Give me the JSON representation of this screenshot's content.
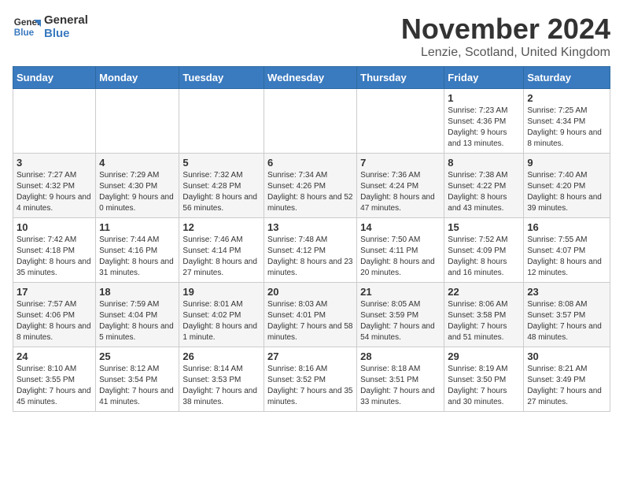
{
  "logo": {
    "line1": "General",
    "line2": "Blue"
  },
  "title": "November 2024",
  "location": "Lenzie, Scotland, United Kingdom",
  "days_of_week": [
    "Sunday",
    "Monday",
    "Tuesday",
    "Wednesday",
    "Thursday",
    "Friday",
    "Saturday"
  ],
  "weeks": [
    [
      {
        "day": "",
        "info": ""
      },
      {
        "day": "",
        "info": ""
      },
      {
        "day": "",
        "info": ""
      },
      {
        "day": "",
        "info": ""
      },
      {
        "day": "",
        "info": ""
      },
      {
        "day": "1",
        "info": "Sunrise: 7:23 AM\nSunset: 4:36 PM\nDaylight: 9 hours and 13 minutes."
      },
      {
        "day": "2",
        "info": "Sunrise: 7:25 AM\nSunset: 4:34 PM\nDaylight: 9 hours and 8 minutes."
      }
    ],
    [
      {
        "day": "3",
        "info": "Sunrise: 7:27 AM\nSunset: 4:32 PM\nDaylight: 9 hours and 4 minutes."
      },
      {
        "day": "4",
        "info": "Sunrise: 7:29 AM\nSunset: 4:30 PM\nDaylight: 9 hours and 0 minutes."
      },
      {
        "day": "5",
        "info": "Sunrise: 7:32 AM\nSunset: 4:28 PM\nDaylight: 8 hours and 56 minutes."
      },
      {
        "day": "6",
        "info": "Sunrise: 7:34 AM\nSunset: 4:26 PM\nDaylight: 8 hours and 52 minutes."
      },
      {
        "day": "7",
        "info": "Sunrise: 7:36 AM\nSunset: 4:24 PM\nDaylight: 8 hours and 47 minutes."
      },
      {
        "day": "8",
        "info": "Sunrise: 7:38 AM\nSunset: 4:22 PM\nDaylight: 8 hours and 43 minutes."
      },
      {
        "day": "9",
        "info": "Sunrise: 7:40 AM\nSunset: 4:20 PM\nDaylight: 8 hours and 39 minutes."
      }
    ],
    [
      {
        "day": "10",
        "info": "Sunrise: 7:42 AM\nSunset: 4:18 PM\nDaylight: 8 hours and 35 minutes."
      },
      {
        "day": "11",
        "info": "Sunrise: 7:44 AM\nSunset: 4:16 PM\nDaylight: 8 hours and 31 minutes."
      },
      {
        "day": "12",
        "info": "Sunrise: 7:46 AM\nSunset: 4:14 PM\nDaylight: 8 hours and 27 minutes."
      },
      {
        "day": "13",
        "info": "Sunrise: 7:48 AM\nSunset: 4:12 PM\nDaylight: 8 hours and 23 minutes."
      },
      {
        "day": "14",
        "info": "Sunrise: 7:50 AM\nSunset: 4:11 PM\nDaylight: 8 hours and 20 minutes."
      },
      {
        "day": "15",
        "info": "Sunrise: 7:52 AM\nSunset: 4:09 PM\nDaylight: 8 hours and 16 minutes."
      },
      {
        "day": "16",
        "info": "Sunrise: 7:55 AM\nSunset: 4:07 PM\nDaylight: 8 hours and 12 minutes."
      }
    ],
    [
      {
        "day": "17",
        "info": "Sunrise: 7:57 AM\nSunset: 4:06 PM\nDaylight: 8 hours and 8 minutes."
      },
      {
        "day": "18",
        "info": "Sunrise: 7:59 AM\nSunset: 4:04 PM\nDaylight: 8 hours and 5 minutes."
      },
      {
        "day": "19",
        "info": "Sunrise: 8:01 AM\nSunset: 4:02 PM\nDaylight: 8 hours and 1 minute."
      },
      {
        "day": "20",
        "info": "Sunrise: 8:03 AM\nSunset: 4:01 PM\nDaylight: 7 hours and 58 minutes."
      },
      {
        "day": "21",
        "info": "Sunrise: 8:05 AM\nSunset: 3:59 PM\nDaylight: 7 hours and 54 minutes."
      },
      {
        "day": "22",
        "info": "Sunrise: 8:06 AM\nSunset: 3:58 PM\nDaylight: 7 hours and 51 minutes."
      },
      {
        "day": "23",
        "info": "Sunrise: 8:08 AM\nSunset: 3:57 PM\nDaylight: 7 hours and 48 minutes."
      }
    ],
    [
      {
        "day": "24",
        "info": "Sunrise: 8:10 AM\nSunset: 3:55 PM\nDaylight: 7 hours and 45 minutes."
      },
      {
        "day": "25",
        "info": "Sunrise: 8:12 AM\nSunset: 3:54 PM\nDaylight: 7 hours and 41 minutes."
      },
      {
        "day": "26",
        "info": "Sunrise: 8:14 AM\nSunset: 3:53 PM\nDaylight: 7 hours and 38 minutes."
      },
      {
        "day": "27",
        "info": "Sunrise: 8:16 AM\nSunset: 3:52 PM\nDaylight: 7 hours and 35 minutes."
      },
      {
        "day": "28",
        "info": "Sunrise: 8:18 AM\nSunset: 3:51 PM\nDaylight: 7 hours and 33 minutes."
      },
      {
        "day": "29",
        "info": "Sunrise: 8:19 AM\nSunset: 3:50 PM\nDaylight: 7 hours and 30 minutes."
      },
      {
        "day": "30",
        "info": "Sunrise: 8:21 AM\nSunset: 3:49 PM\nDaylight: 7 hours and 27 minutes."
      }
    ]
  ]
}
